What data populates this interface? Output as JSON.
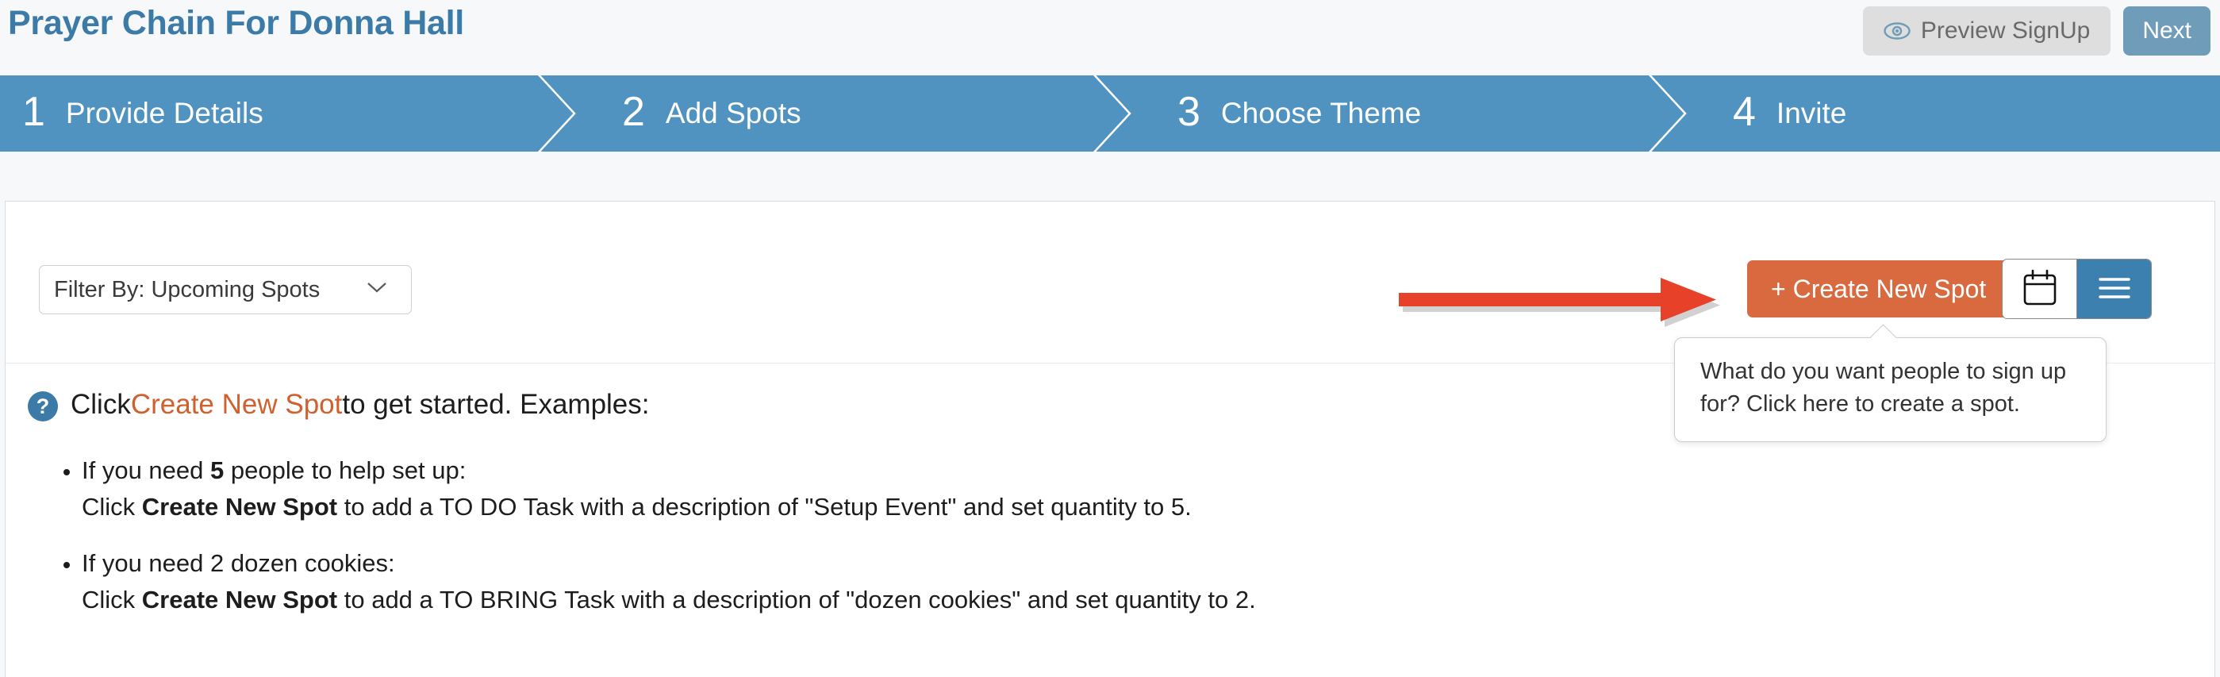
{
  "header": {
    "title": "Prayer Chain For Donna Hall",
    "preview_label": "Preview SignUp",
    "preview_icon": "eye-icon",
    "next_label": "Next"
  },
  "steps": [
    {
      "number": "1",
      "label": "Provide Details"
    },
    {
      "number": "2",
      "label": "Add Spots"
    },
    {
      "number": "3",
      "label": "Choose Theme"
    },
    {
      "number": "4",
      "label": "Invite"
    }
  ],
  "toolbar": {
    "filter_value": "Filter By: Upcoming Spots",
    "filter_options": [
      "Filter By: Upcoming Spots"
    ],
    "create_label": "+ Create New Spot",
    "calendar_icon": "calendar-icon",
    "list_icon": "list-view-icon"
  },
  "tooltip": {
    "text": "What do you want people to sign up for? Click here to create a spot."
  },
  "help": {
    "icon": "question-mark-icon",
    "lead_before": "Click ",
    "lead_accent": "Create New Spot",
    "lead_after": " to get started. Examples:",
    "examples": [
      {
        "line1_a": "If you need ",
        "line1_bold": "5",
        "line1_b": " people to help set up:",
        "line2_a": "Click ",
        "line2_bold": "Create New Spot",
        "line2_b": " to add a TO DO Task with a description of \"Setup Event\" and set quantity to 5."
      },
      {
        "line1_a": "If you need 2 dozen cookies:",
        "line1_bold": "",
        "line1_b": "",
        "line2_a": "Click ",
        "line2_bold": "Create New Spot",
        "line2_b": " to add a TO BRING Task with a description of \"dozen cookies\" and set quantity to 2."
      }
    ]
  },
  "annotation": {
    "arrow_color": "#e8412a",
    "arrow_direction": "right"
  },
  "colors": {
    "brand_blue": "#5093c0",
    "title_blue": "#3c7ba8",
    "accent_orange": "#d96a3f",
    "next_blue": "#6f9cb8",
    "page_bg": "#f6f8fa"
  }
}
